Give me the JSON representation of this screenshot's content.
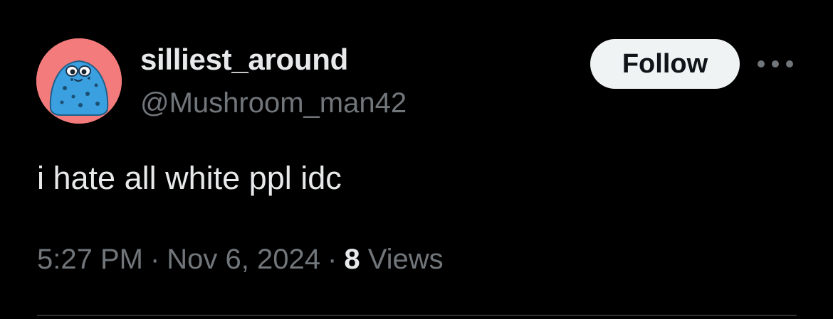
{
  "user": {
    "display_name": "silliest_around",
    "handle": "@Mushroom_man42",
    "avatar_icon": "blob-creature-avatar-icon"
  },
  "actions": {
    "follow_label": "Follow",
    "more_icon": "more-horizontal-icon"
  },
  "tweet": {
    "text": "i hate all white ppl idc",
    "time": "5:27 PM",
    "date": "Nov 6, 2024",
    "separator": "·",
    "views_count": "8",
    "views_label": "Views"
  },
  "colors": {
    "background": "#000000",
    "primary_text": "#e7e9ea",
    "secondary_text": "#71767b",
    "follow_button_bg": "#eff3f4",
    "avatar_bg": "#f47b7b",
    "avatar_creature": "#3aa0e0",
    "divider": "#2f3336"
  }
}
